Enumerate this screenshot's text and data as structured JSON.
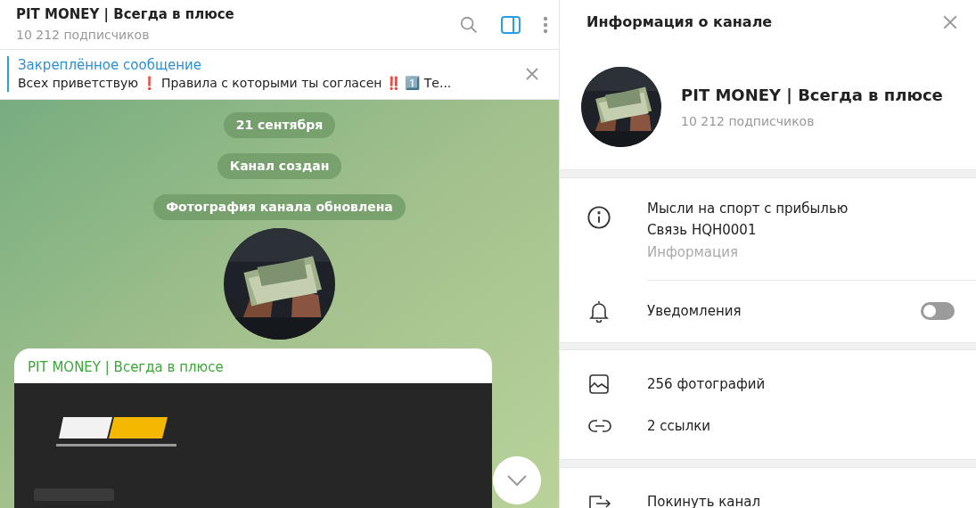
{
  "chat_header": {
    "title": "PIT MONEY | Всегда в плюсе",
    "subtitle": "10 212 подписчиков",
    "panel_toggle_on": true
  },
  "pinned": {
    "label": "Закреплённое сообщение",
    "text": "Всех приветствую  ❗ Правила с которыми ты согласен ‼️  1️⃣ Те..."
  },
  "service_messages": [
    {
      "text": "21 сентября"
    },
    {
      "text": "Канал создан"
    },
    {
      "text": "Фотография канала обновлена"
    }
  ],
  "message": {
    "author": "PIT MONEY | Всегда в плюсе"
  },
  "info_panel": {
    "title": "Информация о канале",
    "name": "PIT MONEY | Всегда в плюсе",
    "subtitle": "10 212 подписчиков",
    "description_lines": [
      "Мысли на спорт с прибылью",
      "Связь HQH0001"
    ],
    "description_caption": "Информация",
    "notifications": {
      "label": "Уведомления",
      "on": false
    },
    "media_rows": [
      {
        "kind": "photos",
        "label": "256 фотографий"
      },
      {
        "kind": "links",
        "label": "2 ссылки"
      }
    ],
    "leave": {
      "label": "Покинуть канал"
    }
  }
}
